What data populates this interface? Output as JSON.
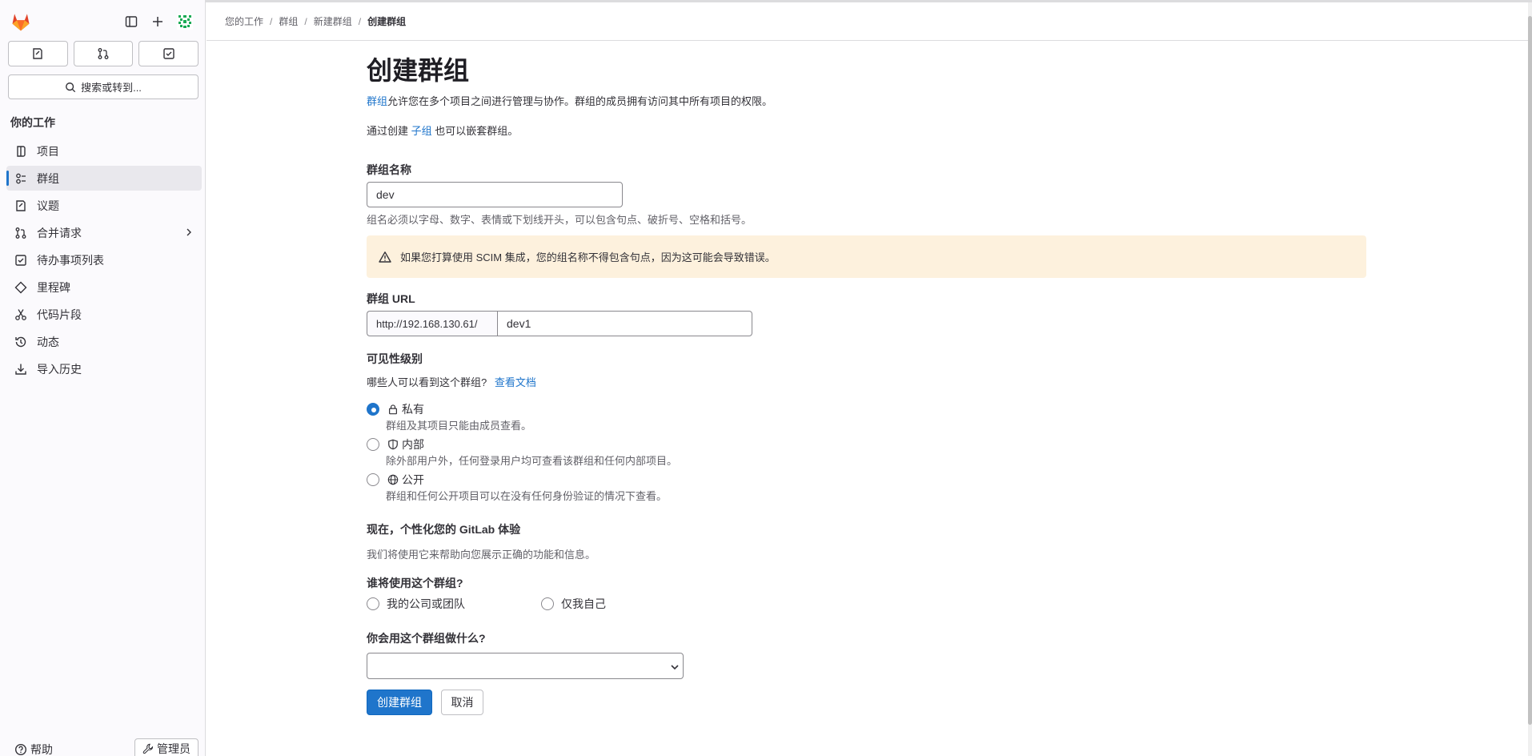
{
  "sidebar": {
    "search_label": "搜索或转到...",
    "section_title": "你的工作",
    "items": [
      {
        "label": "项目"
      },
      {
        "label": "群组"
      },
      {
        "label": "议题"
      },
      {
        "label": "合并请求"
      },
      {
        "label": "待办事项列表"
      },
      {
        "label": "里程碑"
      },
      {
        "label": "代码片段"
      },
      {
        "label": "动态"
      },
      {
        "label": "导入历史"
      }
    ],
    "active_item": "群组",
    "help_label": "帮助",
    "admin_label": "管理员"
  },
  "breadcrumb": [
    "您的工作",
    "群组",
    "新建群组",
    "创建群组"
  ],
  "page": {
    "title": "创建群组",
    "desc_link": "群组",
    "desc_text": "允许您在多个项目之间进行管理与协作。群组的成员拥有访问其中所有项目的权限。",
    "sub_prefix": "通过创建 ",
    "sub_link": "子组",
    "sub_suffix": " 也可以嵌套群组。"
  },
  "form": {
    "name_label": "群组名称",
    "name_value": "dev",
    "name_help": "组名必须以字母、数字、表情或下划线开头，可以包含句点、破折号、空格和括号。",
    "alert_text": "如果您打算使用 SCIM 集成，您的组名称不得包含句点，因为这可能会导致错误。",
    "url_label": "群组 URL",
    "url_prefix": "http://192.168.130.61/",
    "url_value": "dev1",
    "visibility_label": "可见性级别",
    "visibility_question": "哪些人可以看到这个群组?",
    "visibility_doc_link": "查看文档",
    "visibility_options": [
      {
        "label": "私有",
        "help": "群组及其项目只能由成员查看。",
        "icon": "lock-icon",
        "checked": true
      },
      {
        "label": "内部",
        "help": "除外部用户外，任何登录用户均可查看该群组和任何内部项目。",
        "icon": "shield-icon",
        "checked": false
      },
      {
        "label": "公开",
        "help": "群组和任何公开项目可以在没有任何身份验证的情况下查看。",
        "icon": "earth-icon",
        "checked": false
      }
    ],
    "personalize_title": "现在，个性化您的 GitLab 体验",
    "personalize_help": "我们将使用它来帮助向您展示正确的功能和信息。",
    "who_label": "谁将使用这个群组?",
    "who_options": [
      {
        "label": "我的公司或团队",
        "checked": false
      },
      {
        "label": "仅我自己",
        "checked": false
      }
    ],
    "purpose_label": "你会用这个群组做什么?",
    "purpose_value": "",
    "submit_label": "创建群组",
    "cancel_label": "取消"
  },
  "colors": {
    "accent": "#1f75cb",
    "alert_bg": "#fdf1dd",
    "logo_orange": "#e24329"
  }
}
